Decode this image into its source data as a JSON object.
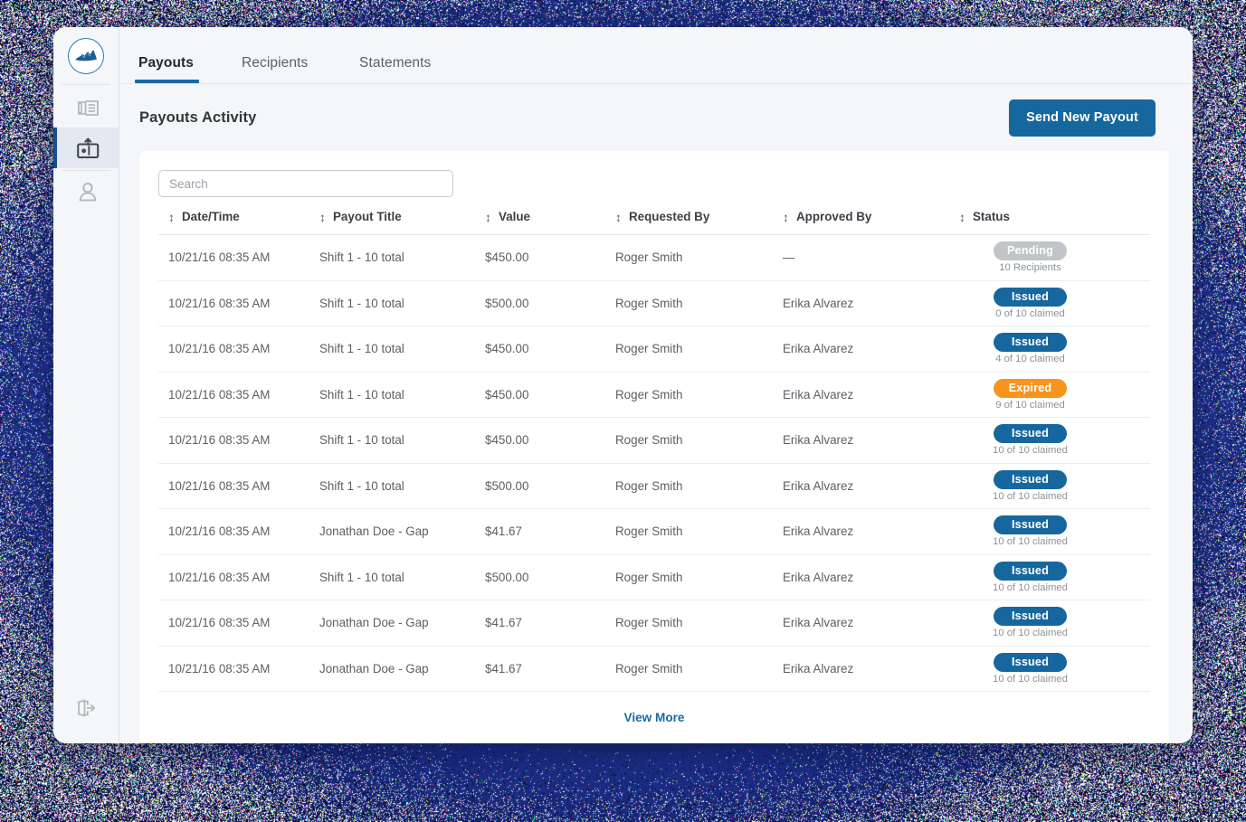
{
  "sidebar": {
    "logo_icon": "mountain-logo-icon",
    "items": [
      {
        "icon": "ledger-book-icon",
        "name": "ledger",
        "active": false
      },
      {
        "icon": "payout-card-upload-icon",
        "name": "payouts",
        "active": true
      },
      {
        "icon": "person-icon",
        "name": "recipients",
        "active": false
      }
    ],
    "bottom_item": {
      "icon": "logout-icon",
      "name": "logout"
    }
  },
  "tabs": [
    {
      "label": "Payouts",
      "active": true
    },
    {
      "label": "Recipients",
      "active": false
    },
    {
      "label": "Statements",
      "active": false
    }
  ],
  "header": {
    "title": "Payouts Activity",
    "primary_button": "Send New Payout"
  },
  "search": {
    "value": "",
    "placeholder": "Search"
  },
  "table": {
    "columns": [
      {
        "key": "date",
        "label": "Date/Time",
        "sortable": true
      },
      {
        "key": "title",
        "label": "Payout Title",
        "sortable": true
      },
      {
        "key": "value",
        "label": "Value",
        "sortable": true
      },
      {
        "key": "requested_by",
        "label": "Requested By",
        "sortable": true
      },
      {
        "key": "approved_by",
        "label": "Approved By",
        "sortable": true
      },
      {
        "key": "status",
        "label": "Status",
        "sortable": true
      }
    ],
    "rows": [
      {
        "date": "10/21/16 08:35 AM",
        "title": "Shift 1 - 10 total",
        "value": "$450.00",
        "requested_by": "Roger Smith",
        "approved_by": "—",
        "status": "Pending",
        "status_kind": "pending",
        "sub": "10 Recipients"
      },
      {
        "date": "10/21/16 08:35 AM",
        "title": "Shift 1 - 10 total",
        "value": "$500.00",
        "requested_by": "Roger Smith",
        "approved_by": "Erika Alvarez",
        "status": "Issued",
        "status_kind": "issued",
        "sub": "0 of 10 claimed"
      },
      {
        "date": "10/21/16 08:35 AM",
        "title": "Shift 1 - 10 total",
        "value": "$450.00",
        "requested_by": "Roger Smith",
        "approved_by": "Erika Alvarez",
        "status": "Issued",
        "status_kind": "issued",
        "sub": "4 of 10 claimed"
      },
      {
        "date": "10/21/16 08:35 AM",
        "title": "Shift 1 - 10 total",
        "value": "$450.00",
        "requested_by": "Roger Smith",
        "approved_by": "Erika Alvarez",
        "status": "Expired",
        "status_kind": "expired",
        "sub": "9 of 10 claimed"
      },
      {
        "date": "10/21/16 08:35 AM",
        "title": "Shift 1 - 10 total",
        "value": "$450.00",
        "requested_by": "Roger Smith",
        "approved_by": "Erika Alvarez",
        "status": "Issued",
        "status_kind": "issued",
        "sub": "10 of 10 claimed"
      },
      {
        "date": "10/21/16 08:35 AM",
        "title": "Shift 1 - 10 total",
        "value": "$500.00",
        "requested_by": "Roger Smith",
        "approved_by": "Erika Alvarez",
        "status": "Issued",
        "status_kind": "issued",
        "sub": "10 of 10 claimed"
      },
      {
        "date": "10/21/16 08:35 AM",
        "title": "Jonathan Doe - Gap",
        "value": "$41.67",
        "requested_by": "Roger Smith",
        "approved_by": "Erika Alvarez",
        "status": "Issued",
        "status_kind": "issued",
        "sub": "10 of 10 claimed"
      },
      {
        "date": "10/21/16 08:35 AM",
        "title": "Shift 1 - 10 total",
        "value": "$500.00",
        "requested_by": "Roger Smith",
        "approved_by": "Erika Alvarez",
        "status": "Issued",
        "status_kind": "issued",
        "sub": "10 of 10 claimed"
      },
      {
        "date": "10/21/16 08:35 AM",
        "title": "Jonathan Doe - Gap",
        "value": "$41.67",
        "requested_by": "Roger Smith",
        "approved_by": "Erika Alvarez",
        "status": "Issued",
        "status_kind": "issued",
        "sub": "10 of 10 claimed"
      },
      {
        "date": "10/21/16 08:35 AM",
        "title": "Jonathan Doe - Gap",
        "value": "$41.67",
        "requested_by": "Roger Smith",
        "approved_by": "Erika Alvarez",
        "status": "Issued",
        "status_kind": "issued",
        "sub": "10 of 10 claimed"
      }
    ],
    "view_more": "View More"
  },
  "colors": {
    "accent_blue": "#17679f",
    "tab_underline": "#1a6aa6",
    "badge_pending": "#c1c4c8",
    "badge_issued": "#17679f",
    "badge_expired": "#f7941e",
    "backdrop_navy": "#24378a",
    "card_bg": "#f4f6f9",
    "active_rail": "#e4e8f1",
    "active_rail_border": "#1b4f86"
  }
}
